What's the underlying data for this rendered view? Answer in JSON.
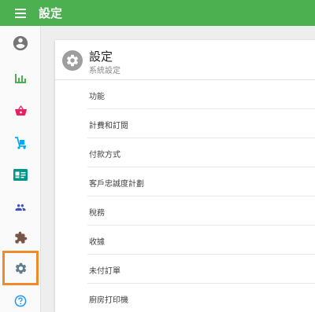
{
  "topbar": {
    "title": "設定",
    "menu_icon": "hamburger-menu-icon",
    "color": "#4caf50"
  },
  "sidebar": {
    "items": [
      {
        "id": "account",
        "icon": "account-circle-icon",
        "color": "#757575"
      },
      {
        "id": "reports",
        "icon": "bar-chart-icon",
        "color": "#4caf50"
      },
      {
        "id": "sales",
        "icon": "basket-icon",
        "color": "#e91e63"
      },
      {
        "id": "delivery",
        "icon": "hand-truck-icon",
        "color": "#03a9f4"
      },
      {
        "id": "customers",
        "icon": "contact-card-icon",
        "color": "#009688"
      },
      {
        "id": "staff",
        "icon": "people-icon",
        "color": "#3f51b5"
      },
      {
        "id": "addons",
        "icon": "puzzle-icon",
        "color": "#795548"
      },
      {
        "id": "settings",
        "icon": "gear-icon",
        "color": "#607d8b",
        "active": true
      },
      {
        "id": "help",
        "icon": "help-circle-icon",
        "color": "#2196f3"
      }
    ],
    "active_highlight": "#f08a2c"
  },
  "settings_card": {
    "title": "設定",
    "subtitle": "系統設定",
    "icon": "gear-icon",
    "items": [
      {
        "label": "功能"
      },
      {
        "label": "計費和訂閱"
      },
      {
        "label": "付款方式"
      },
      {
        "label": "客戶忠誠度計劃"
      },
      {
        "label": "稅務"
      },
      {
        "label": "收據"
      },
      {
        "label": "未付訂單"
      },
      {
        "label": "廚房打印機"
      }
    ]
  }
}
